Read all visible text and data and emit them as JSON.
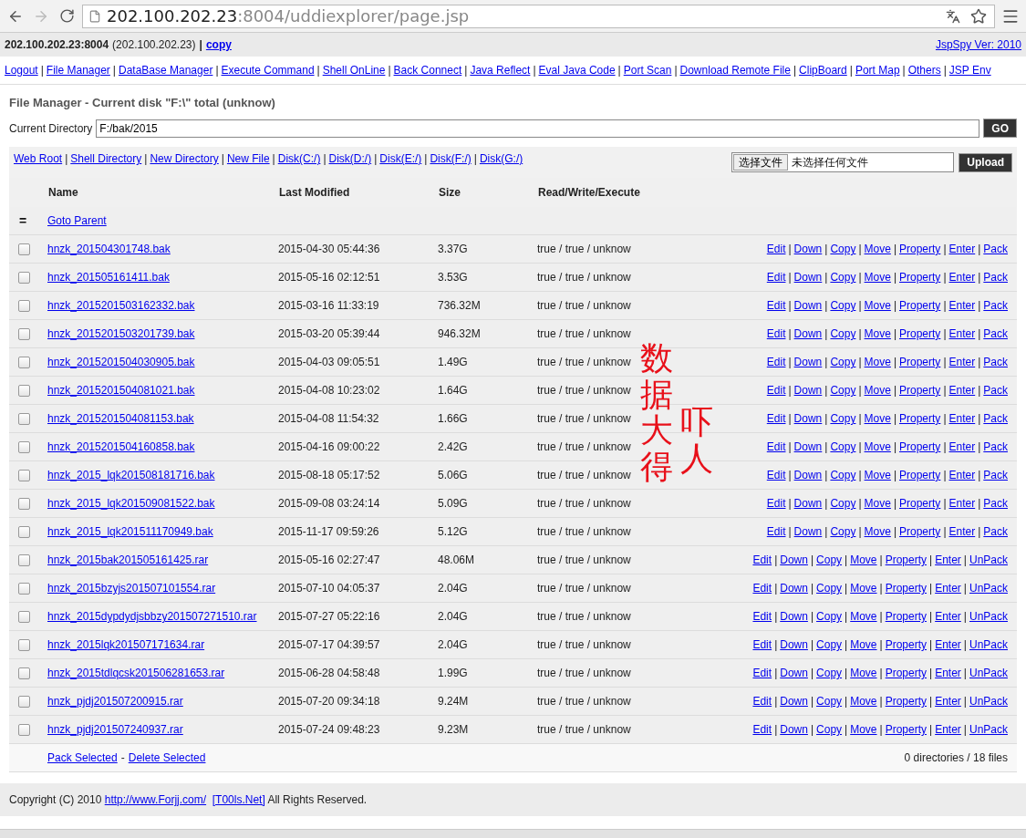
{
  "browser": {
    "url_host": "202.100.202.23",
    "url_rest": ":8004/uddiexplorer/page.jsp"
  },
  "info_bar": {
    "host": "202.100.202.23:8004",
    "ip": "(202.100.202.23)",
    "separator": "|",
    "copy": "copy",
    "version": "JspSpy Ver: 2010"
  },
  "nav": {
    "separator": "|",
    "links": [
      "Logout",
      "File Manager",
      "DataBase Manager",
      "Execute Command",
      "Shell OnLine",
      "Back Connect",
      "Java Reflect",
      "Eval Java Code",
      "Port Scan",
      "Download Remote File",
      "ClipBoard",
      "Port Map",
      "Others",
      "JSP Env"
    ]
  },
  "title": "File Manager - Current disk \"F:\\\" total (unknow)",
  "directory": {
    "label": "Current Directory",
    "value": "F:/bak/2015",
    "button": "GO"
  },
  "toolbar": {
    "separator": "|",
    "links": [
      "Web Root",
      "Shell Directory",
      "New Directory",
      "New File",
      "Disk(C:/)",
      "Disk(D:/)",
      "Disk(E:/)",
      "Disk(F:/)",
      "Disk(G:/)"
    ],
    "choose_button": "选择文件",
    "file_status": "未选择任何文件",
    "upload_button": "Upload"
  },
  "table": {
    "columns": [
      "Name",
      "Last Modified",
      "Size",
      "Read/Write/Execute"
    ],
    "parent": {
      "icon": "=",
      "label": "Goto Parent"
    },
    "action_separator": "|",
    "rows": [
      {
        "name": "hnzk_201504301748.bak",
        "modified": "2015-04-30 05:44:36",
        "size": "3.37G",
        "rwe": "true / true / unknow",
        "checked": false,
        "actions": [
          "Edit",
          "Down",
          "Copy",
          "Move",
          "Property",
          "Enter",
          "Pack"
        ]
      },
      {
        "name": "hnzk_201505161411.bak",
        "modified": "2015-05-16 02:12:51",
        "size": "3.53G",
        "rwe": "true / true / unknow",
        "checked": false,
        "actions": [
          "Edit",
          "Down",
          "Copy",
          "Move",
          "Property",
          "Enter",
          "Pack"
        ]
      },
      {
        "name": "hnzk_2015201503162332.bak",
        "modified": "2015-03-16 11:33:19",
        "size": "736.32M",
        "rwe": "true / true / unknow",
        "checked": false,
        "actions": [
          "Edit",
          "Down",
          "Copy",
          "Move",
          "Property",
          "Enter",
          "Pack"
        ]
      },
      {
        "name": "hnzk_2015201503201739.bak",
        "modified": "2015-03-20 05:39:44",
        "size": "946.32M",
        "rwe": "true / true / unknow",
        "checked": false,
        "actions": [
          "Edit",
          "Down",
          "Copy",
          "Move",
          "Property",
          "Enter",
          "Pack"
        ]
      },
      {
        "name": "hnzk_2015201504030905.bak",
        "modified": "2015-04-03 09:05:51",
        "size": "1.49G",
        "rwe": "true / true / unknow",
        "checked": false,
        "actions": [
          "Edit",
          "Down",
          "Copy",
          "Move",
          "Property",
          "Enter",
          "Pack"
        ]
      },
      {
        "name": "hnzk_2015201504081021.bak",
        "modified": "2015-04-08 10:23:02",
        "size": "1.64G",
        "rwe": "true / true / unknow",
        "checked": false,
        "actions": [
          "Edit",
          "Down",
          "Copy",
          "Move",
          "Property",
          "Enter",
          "Pack"
        ]
      },
      {
        "name": "hnzk_2015201504081153.bak",
        "modified": "2015-04-08 11:54:32",
        "size": "1.66G",
        "rwe": "true / true / unknow",
        "checked": false,
        "actions": [
          "Edit",
          "Down",
          "Copy",
          "Move",
          "Property",
          "Enter",
          "Pack"
        ]
      },
      {
        "name": "hnzk_2015201504160858.bak",
        "modified": "2015-04-16 09:00:22",
        "size": "2.42G",
        "rwe": "true / true / unknow",
        "checked": false,
        "actions": [
          "Edit",
          "Down",
          "Copy",
          "Move",
          "Property",
          "Enter",
          "Pack"
        ]
      },
      {
        "name": "hnzk_2015_lqk201508181716.bak",
        "modified": "2015-08-18 05:17:52",
        "size": "5.06G",
        "rwe": "true / true / unknow",
        "checked": false,
        "actions": [
          "Edit",
          "Down",
          "Copy",
          "Move",
          "Property",
          "Enter",
          "Pack"
        ]
      },
      {
        "name": "hnzk_2015_lqk201509081522.bak",
        "modified": "2015-09-08 03:24:14",
        "size": "5.09G",
        "rwe": "true / true / unknow",
        "checked": false,
        "actions": [
          "Edit",
          "Down",
          "Copy",
          "Move",
          "Property",
          "Enter",
          "Pack"
        ]
      },
      {
        "name": "hnzk_2015_lqk201511170949.bak",
        "modified": "2015-11-17 09:59:26",
        "size": "5.12G",
        "rwe": "true / true / unknow",
        "checked": false,
        "actions": [
          "Edit",
          "Down",
          "Copy",
          "Move",
          "Property",
          "Enter",
          "Pack"
        ]
      },
      {
        "name": "hnzk_2015bak201505161425.rar",
        "modified": "2015-05-16 02:27:47",
        "size": "48.06M",
        "rwe": "true / true / unknow",
        "checked": false,
        "actions": [
          "Edit",
          "Down",
          "Copy",
          "Move",
          "Property",
          "Enter",
          "UnPack"
        ]
      },
      {
        "name": "hnzk_2015bzyjs201507101554.rar",
        "modified": "2015-07-10 04:05:37",
        "size": "2.04G",
        "rwe": "true / true / unknow",
        "checked": false,
        "actions": [
          "Edit",
          "Down",
          "Copy",
          "Move",
          "Property",
          "Enter",
          "UnPack"
        ]
      },
      {
        "name": "hnzk_2015dypdydjsbbzy201507271510.rar",
        "modified": "2015-07-27 05:22:16",
        "size": "2.04G",
        "rwe": "true / true / unknow",
        "checked": false,
        "actions": [
          "Edit",
          "Down",
          "Copy",
          "Move",
          "Property",
          "Enter",
          "UnPack"
        ]
      },
      {
        "name": "hnzk_2015lqk201507171634.rar",
        "modified": "2015-07-17 04:39:57",
        "size": "2.04G",
        "rwe": "true / true / unknow",
        "checked": false,
        "actions": [
          "Edit",
          "Down",
          "Copy",
          "Move",
          "Property",
          "Enter",
          "UnPack"
        ]
      },
      {
        "name": "hnzk_2015tdlqcsk201506281653.rar",
        "modified": "2015-06-28 04:58:48",
        "size": "1.99G",
        "rwe": "true / true / unknow",
        "checked": false,
        "actions": [
          "Edit",
          "Down",
          "Copy",
          "Move",
          "Property",
          "Enter",
          "UnPack"
        ]
      },
      {
        "name": "hnzk_pjdj201507200915.rar",
        "modified": "2015-07-20 09:34:18",
        "size": "9.24M",
        "rwe": "true / true / unknow",
        "checked": false,
        "actions": [
          "Edit",
          "Down",
          "Copy",
          "Move",
          "Property",
          "Enter",
          "UnPack"
        ]
      },
      {
        "name": "hnzk_pjdj201507240937.rar",
        "modified": "2015-07-24 09:48:23",
        "size": "9.23M",
        "rwe": "true / true / unknow",
        "checked": false,
        "actions": [
          "Edit",
          "Down",
          "Copy",
          "Move",
          "Property",
          "Enter",
          "UnPack"
        ]
      }
    ],
    "footer": {
      "pack": "Pack Selected",
      "dash": "-",
      "delete": "Delete Selected",
      "summary": "0 directories / 18 files"
    }
  },
  "annotation": {
    "lines": [
      "数据大得",
      "吓人"
    ]
  },
  "copyright": {
    "before": "Copyright (C) 2010 ",
    "link1": "http://www.Forjj.com/",
    "link2": "[T00ls.Net]",
    "after": " All Rights Reserved."
  }
}
